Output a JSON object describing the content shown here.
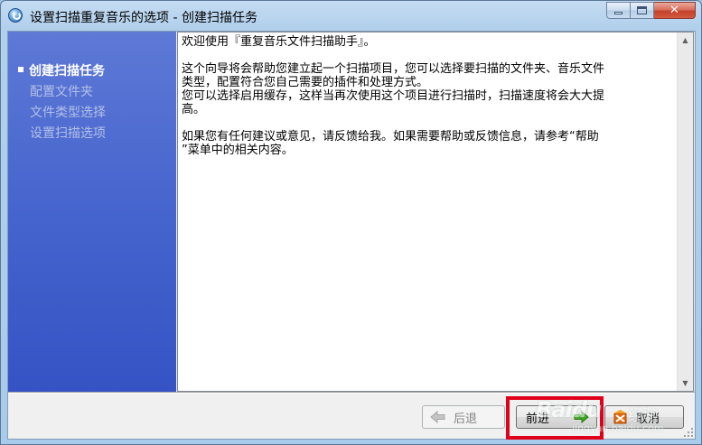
{
  "window": {
    "title": "设置扫描重复音乐的选项 - 创建扫描任务",
    "close_glyph": "✕"
  },
  "sidebar": {
    "steps": [
      {
        "label": "创建扫描任务",
        "active": true
      },
      {
        "label": "配置文件夹",
        "active": false
      },
      {
        "label": "文件类型选择",
        "active": false
      },
      {
        "label": "设置扫描选项",
        "active": false
      }
    ]
  },
  "content": {
    "welcome": "欢迎使用『重复音乐文件扫描助手』。",
    "intro_line1": "这个向导将会帮助您建立起一个扫描项目，您可以选择要扫描的文件夹、音乐文件",
    "intro_line2": "类型，配置符合您自己需要的插件和处理方式。",
    "cache_line1": "您可以选择启用缓存，这样当再次使用这个项目进行扫描时，扫描速度将会大大提",
    "cache_line2": "高。",
    "feedback_line1": "如果您有任何建议或意见，请反馈给我。如果需要帮助或反馈信息，请参考“帮助",
    "feedback_line2": "”菜单中的相关内容。"
  },
  "buttons": {
    "back_label": "后退",
    "next_label": "前进",
    "cancel_label": "取消"
  },
  "watermark": {
    "logo": "Baidu",
    "sub": "经验",
    "url": "jingyan.baidu.com"
  },
  "colors": {
    "sidebar_blue": "#4a68cf",
    "highlight_red": "#e0001a",
    "next_arrow_green": "#3aa51f",
    "cancel_icon_orange": "#e06a12"
  }
}
